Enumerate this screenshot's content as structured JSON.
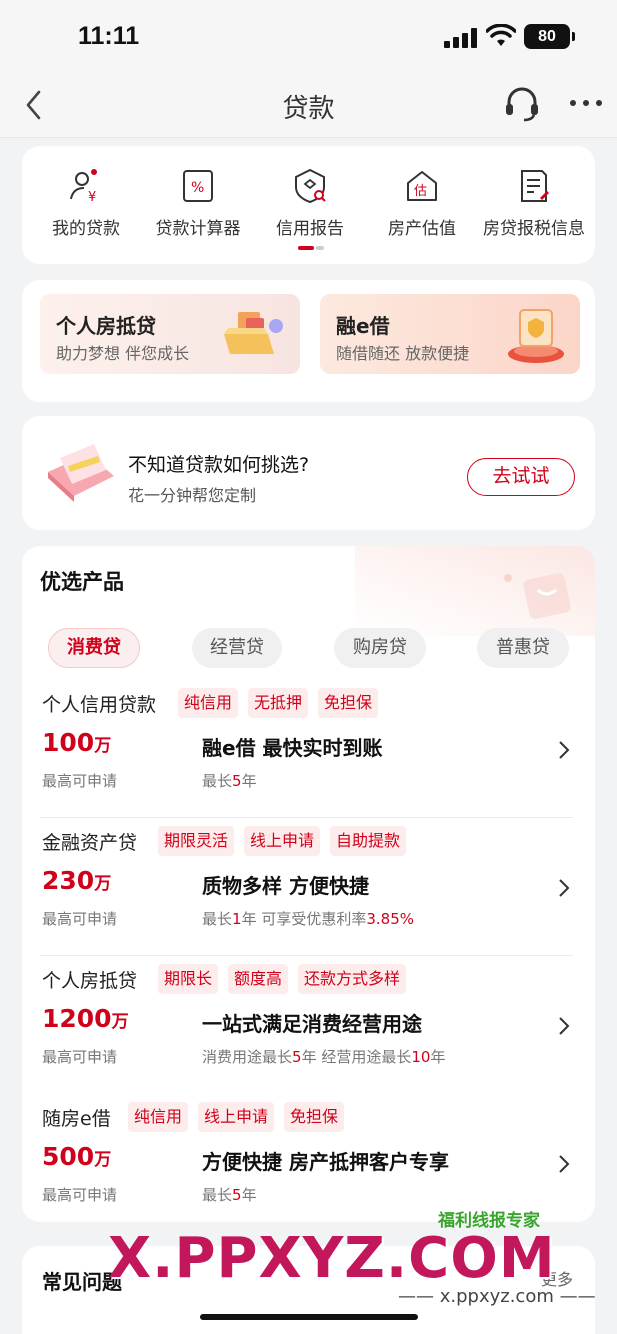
{
  "status": {
    "time": "11:11",
    "battery": "80"
  },
  "nav": {
    "title": "贷款"
  },
  "quick_menu": [
    {
      "label": "我的贷款",
      "icon": "my-loan-icon"
    },
    {
      "label": "贷款计算器",
      "icon": "calculator-icon"
    },
    {
      "label": "信用报告",
      "icon": "credit-report-icon"
    },
    {
      "label": "房产估值",
      "icon": "house-valuation-icon"
    },
    {
      "label": "房贷报税信息",
      "icon": "tax-document-icon"
    }
  ],
  "promos": [
    {
      "title": "个人房抵贷",
      "subtitle": "助力梦想 伴您成长"
    },
    {
      "title": "融e借",
      "subtitle": "随借随还 放款便捷"
    }
  ],
  "advisor": {
    "title": "不知道贷款如何挑选?",
    "subtitle": "花一分钟帮您定制",
    "button": "去试试"
  },
  "products": {
    "title": "优选产品",
    "tabs": [
      "消费贷",
      "经营贷",
      "购房贷",
      "普惠贷"
    ],
    "active_tab": "消费贷",
    "items": [
      {
        "name": "个人信用贷款",
        "tags": [
          "纯信用",
          "无抵押",
          "免担保"
        ],
        "amount": "100",
        "unit": "万",
        "amount_note": "最高可申请",
        "feature": "融e借 最快实时到账",
        "detail_prefix": "最长",
        "detail_highlight": "5",
        "detail_suffix": "年"
      },
      {
        "name": "金融资产贷",
        "tags": [
          "期限灵活",
          "线上申请",
          "自助提款"
        ],
        "amount": "230",
        "unit": "万",
        "amount_note": "最高可申请",
        "feature": "质物多样 方便快捷",
        "detail_prefix": "最长",
        "detail_highlight": "1",
        "detail_suffix": "年  可享受优惠利率",
        "detail_highlight2": "3.85%"
      },
      {
        "name": "个人房抵贷",
        "tags": [
          "期限长",
          "额度高",
          "还款方式多样"
        ],
        "amount": "1200",
        "unit": "万",
        "amount_note": "最高可申请",
        "feature": "一站式满足消费经营用途",
        "detail_prefix": "消费用途最长",
        "detail_highlight": "5",
        "detail_suffix": "年  经营用途最长",
        "detail_highlight2": "10",
        "detail_suffix2": "年"
      },
      {
        "name": "随房e借",
        "tags": [
          "纯信用",
          "线上申请",
          "免担保"
        ],
        "amount": "500",
        "unit": "万",
        "amount_note": "最高可申请",
        "feature": "方便快捷 房产抵押客户专享",
        "detail_prefix": "最长",
        "detail_highlight": "5",
        "detail_suffix": "年"
      }
    ]
  },
  "faq": {
    "title": "常见问题",
    "more": "更多"
  },
  "watermark": {
    "brand": "福利线报专家",
    "big": "X.PPXYZ.COM",
    "small": "—— x.ppxyz.com ——"
  },
  "colors": {
    "brand_red": "#d0021b",
    "tag_bg": "#fdecec",
    "page_bg": "#f2f3f5"
  }
}
